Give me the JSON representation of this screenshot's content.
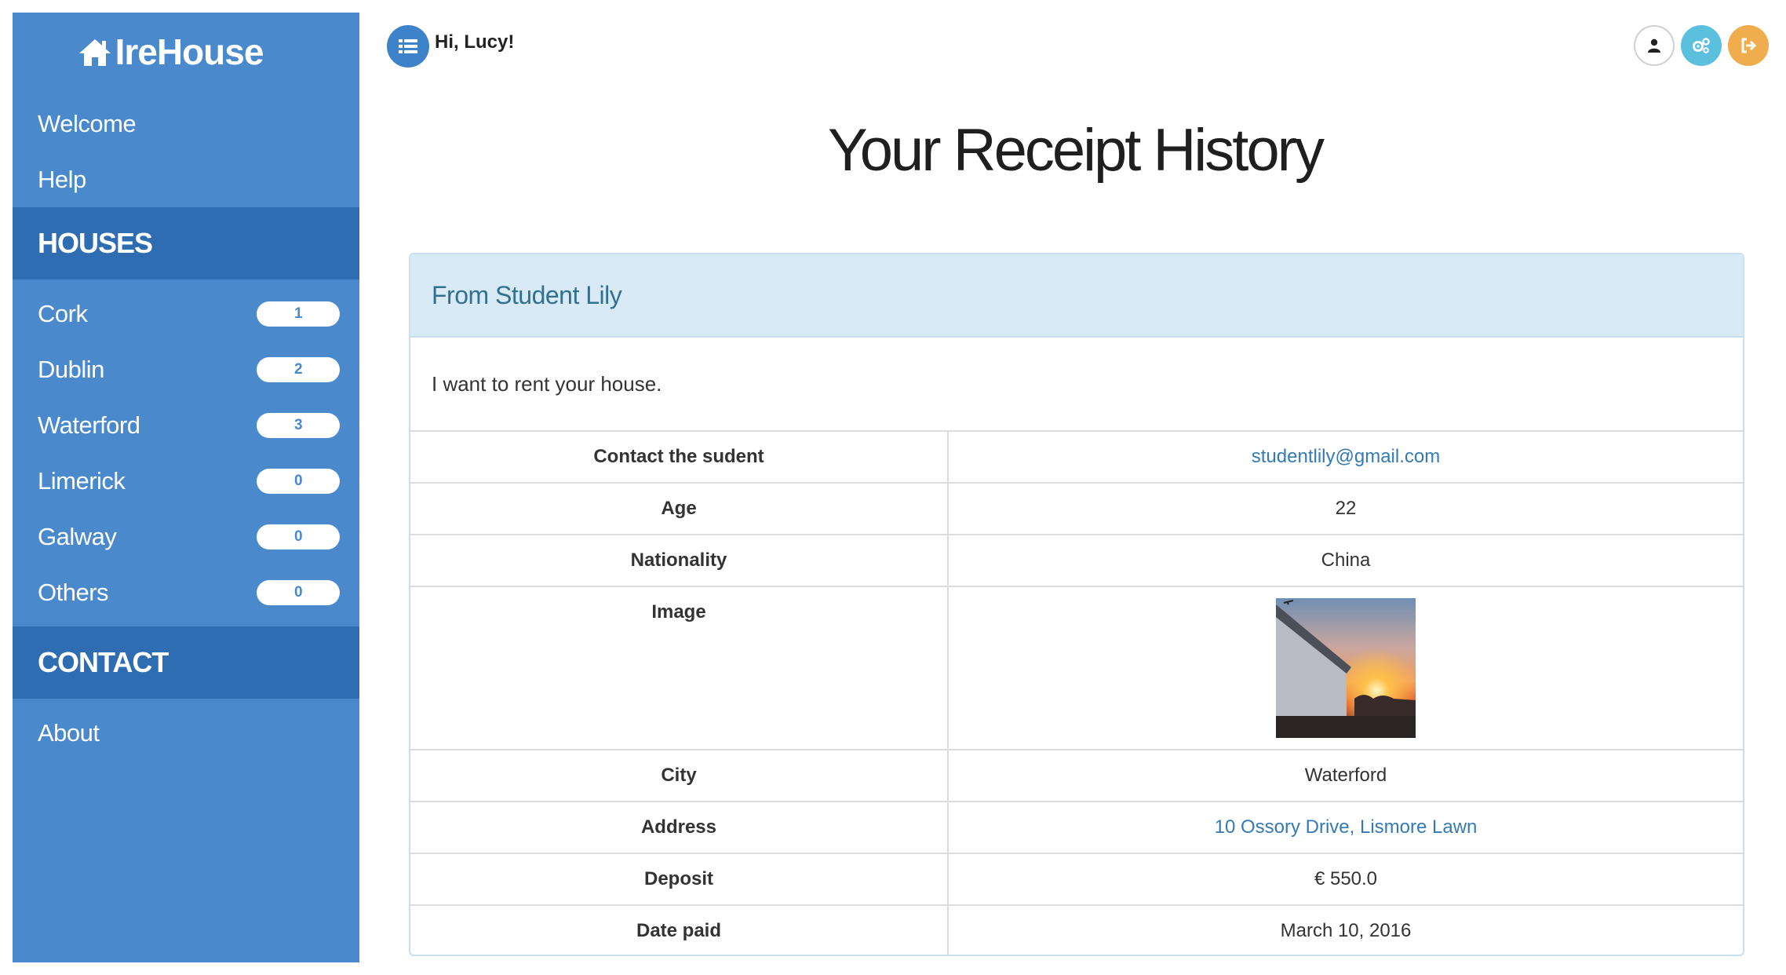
{
  "brand": {
    "name": "IreHouse",
    "icon": "home-icon"
  },
  "sidebar": {
    "top_links": [
      {
        "label": "Welcome"
      },
      {
        "label": "Help"
      }
    ],
    "houses_heading": "HOUSES",
    "cities": [
      {
        "label": "Cork",
        "count": "1"
      },
      {
        "label": "Dublin",
        "count": "2"
      },
      {
        "label": "Waterford",
        "count": "3"
      },
      {
        "label": "Limerick",
        "count": "0"
      },
      {
        "label": "Galway",
        "count": "0"
      },
      {
        "label": "Others",
        "count": "0"
      }
    ],
    "contact_heading": "CONTACT",
    "contact_links": [
      {
        "label": "About"
      }
    ]
  },
  "header": {
    "greeting": "Hi, Lucy!",
    "menu_icon": "list-icon",
    "icons": [
      "user-icon",
      "settings-icon",
      "logout-icon"
    ]
  },
  "page_title": "Your Receipt History",
  "receipt": {
    "heading": "From Student Lily",
    "message": "I want to rent your house.",
    "rows": {
      "contact": {
        "label": "Contact the sudent",
        "value": "studentlily@gmail.com"
      },
      "age": {
        "label": "Age",
        "value": "22"
      },
      "nationality": {
        "label": "Nationality",
        "value": "China"
      },
      "image": {
        "label": "Image"
      },
      "city": {
        "label": "City",
        "value": "Waterford"
      },
      "address": {
        "label": "Address",
        "value": "10 Ossory Drive, Lismore Lawn"
      },
      "deposit": {
        "label": "Deposit",
        "value": "€ 550.0"
      },
      "date_paid": {
        "label": "Date paid",
        "value": "March 10, 2016"
      }
    }
  },
  "colors": {
    "sidebar": "#4a89cc",
    "sidebar_section": "#2e6db2",
    "panel_heading_bg": "#d9eaf7",
    "panel_heading_text": "#31708f",
    "link": "#337ab7"
  }
}
